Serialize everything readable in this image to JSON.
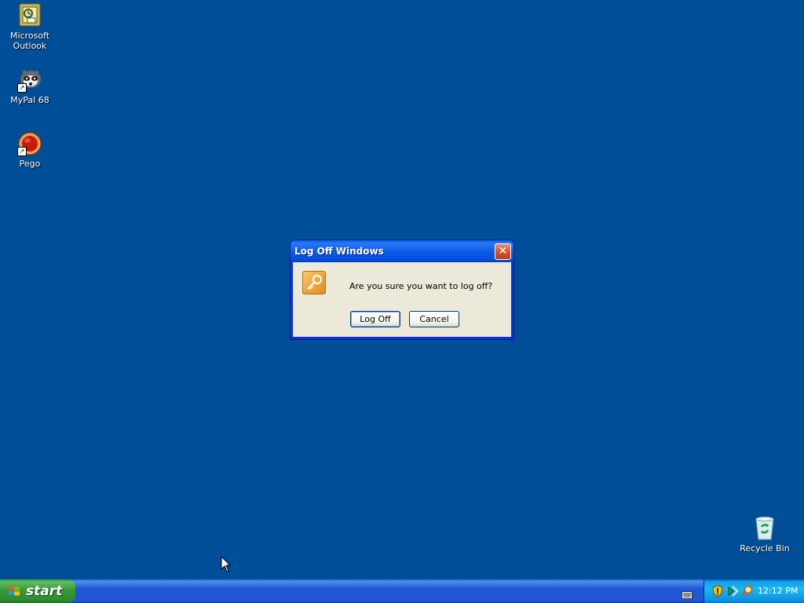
{
  "desktop": {
    "icons": [
      {
        "label_line1": "Microsoft",
        "label_line2": "Outlook",
        "icon": "outlook-icon"
      },
      {
        "label": "MyPal 68",
        "icon": "mypal-icon"
      },
      {
        "label": "Pego",
        "icon": "pego-icon"
      },
      {
        "label": "Recycle Bin",
        "icon": "recycle-bin-icon"
      }
    ],
    "background_color": "#004e98"
  },
  "dialog": {
    "title": "Log Off Windows",
    "close_symbol": "✕",
    "icon": "key-icon",
    "message": "Are you sure you want to log off?",
    "buttons": {
      "logoff_label": "Log Off",
      "cancel_label": "Cancel"
    }
  },
  "taskbar": {
    "start_label": "start",
    "tray": {
      "icons": [
        "security-shield-icon",
        "network-icon",
        "search-icon"
      ],
      "clock": "12:12 PM"
    },
    "keyboard_indicator": "keyboard-icon"
  },
  "colors": {
    "desktop": "#004e98",
    "titlebar": "#0a5fe8",
    "start_button": "#3c9b3c",
    "taskbar": "#2157d7",
    "tray": "#18b9f4",
    "dialog_body": "#ece9d8"
  }
}
